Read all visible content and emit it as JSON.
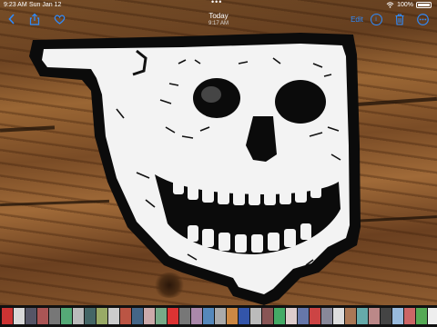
{
  "status_bar": {
    "time": "9:23 AM",
    "date": "Sun Jan 12",
    "battery_text": "100%",
    "wifi_icon": "wifi-icon",
    "battery_icon": "battery-icon"
  },
  "nav_bar": {
    "title": "Today",
    "subtitle": "9:17 AM",
    "edit_label": "Edit",
    "back_icon": "chevron-left-icon",
    "share_icon": "share-icon",
    "favorite_icon": "heart-icon",
    "info_icon": "info-icon",
    "trash_icon": "trash-icon",
    "more_icon": "ellipsis-icon",
    "more_dots": "•••",
    "info_glyph": "i",
    "accent_color": "#2f8cff"
  },
  "photo": {
    "subject": "skull-sticker-icon"
  },
  "thumbnail_strip": {
    "thumbnail_colors": [
      "#c33",
      "#d8d8d8",
      "#556",
      "#a55",
      "#777",
      "#5a7",
      "#bbb",
      "#466",
      "#9a6",
      "#ccc",
      "#b54",
      "#468",
      "#caa",
      "#7a8",
      "#d33",
      "#777",
      "#a8a",
      "#58b",
      "#aaa",
      "#c84",
      "#35a",
      "#bbb",
      "#855",
      "#4a6",
      "#dcc",
      "#67a",
      "#c44",
      "#889",
      "#ddd",
      "#a75",
      "#6aa",
      "#b88",
      "#444",
      "#9bd",
      "#c66",
      "#5a5",
      "#eee",
      "#ddd",
      "#777",
      "#336",
      "#3a3a3a"
    ],
    "selected_index": 37
  }
}
